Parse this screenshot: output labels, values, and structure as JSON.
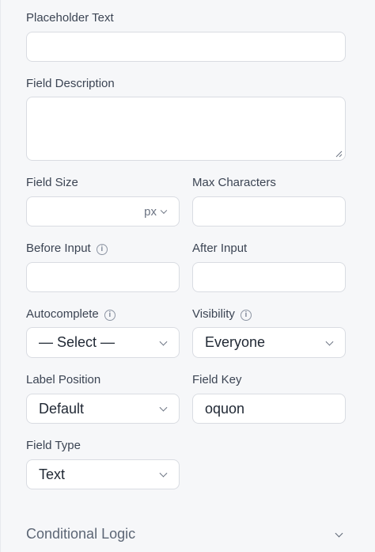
{
  "fields": {
    "placeholder_text": {
      "label": "Placeholder Text",
      "value": ""
    },
    "field_description": {
      "label": "Field Description",
      "value": ""
    },
    "field_size": {
      "label": "Field Size",
      "value": "",
      "unit": "px"
    },
    "max_characters": {
      "label": "Max Characters",
      "value": ""
    },
    "before_input": {
      "label": "Before Input",
      "value": ""
    },
    "after_input": {
      "label": "After Input",
      "value": ""
    },
    "autocomplete": {
      "label": "Autocomplete",
      "selected": "— Select —"
    },
    "visibility": {
      "label": "Visibility",
      "selected": "Everyone"
    },
    "label_position": {
      "label": "Label Position",
      "selected": "Default"
    },
    "field_key": {
      "label": "Field Key",
      "value": "oquon"
    },
    "field_type": {
      "label": "Field Type",
      "selected": "Text"
    }
  },
  "conditional_logic": {
    "label": "Conditional Logic"
  },
  "icons": {
    "info": "info-circle-icon",
    "chevron": "chevron-down-icon",
    "resize": "resize-handle-icon"
  }
}
